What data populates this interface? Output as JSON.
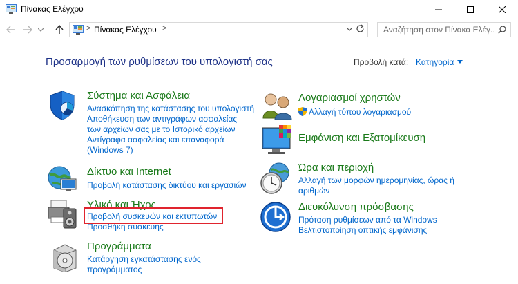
{
  "window": {
    "title": "Πίνακας Ελέγχου"
  },
  "address_bar": {
    "path": "Πίνακας Ελέγχου",
    "separator": ">"
  },
  "search": {
    "placeholder": "Αναζήτηση στον Πίνακα Ελέγ..."
  },
  "header": {
    "title": "Προσαρμογή των ρυθμίσεων του υπολογιστή σας",
    "view_by_label": "Προβολή κατά:",
    "view_by_value": "Κατηγορία"
  },
  "left_categories": [
    {
      "title": "Σύστημα και Ασφάλεια",
      "links": [
        "Ανασκόπηση της κατάστασης του υπολογιστή",
        "Αποθήκευση των αντιγράφων ασφαλείας",
        "των αρχείων σας με το Ιστορικό αρχείων",
        "Αντίγραφα ασφαλείας και επαναφορά",
        "(Windows 7)"
      ]
    },
    {
      "title": "Δίκτυο και Internet",
      "links": [
        "Προβολή κατάστασης δικτύου και εργασιών"
      ]
    },
    {
      "title": "Υλικό και Ήχος",
      "links": [
        "Προβολή συσκευών και εκτυπωτών",
        "Προσθήκη συσκευής"
      ]
    },
    {
      "title": "Προγράμματα",
      "links": [
        "Κατάργηση εγκατάστασης ενός",
        "προγράμματος"
      ]
    }
  ],
  "right_categories": [
    {
      "title": "Λογαριασμοί χρηστών",
      "links": [
        "Αλλαγή τύπου λογαριασμού"
      ]
    },
    {
      "title": "Εμφάνιση και Εξατομίκευση",
      "links": []
    },
    {
      "title": "Ώρα και περιοχή",
      "links": [
        "Αλλαγή των μορφών ημερομηνίας, ώρας ή",
        "αριθμών"
      ]
    },
    {
      "title": "Διευκόλυνση πρόσβασης",
      "links": [
        "Πρόταση ρυθμίσεων από τα Windows",
        "Βελτιστοποίηση οπτικής εμφάνισης"
      ]
    }
  ],
  "colors": {
    "title_blue": "#1e3287",
    "link_blue": "#0066cc",
    "category_green": "#1a7a1a",
    "highlight_red": "#e0242e"
  }
}
